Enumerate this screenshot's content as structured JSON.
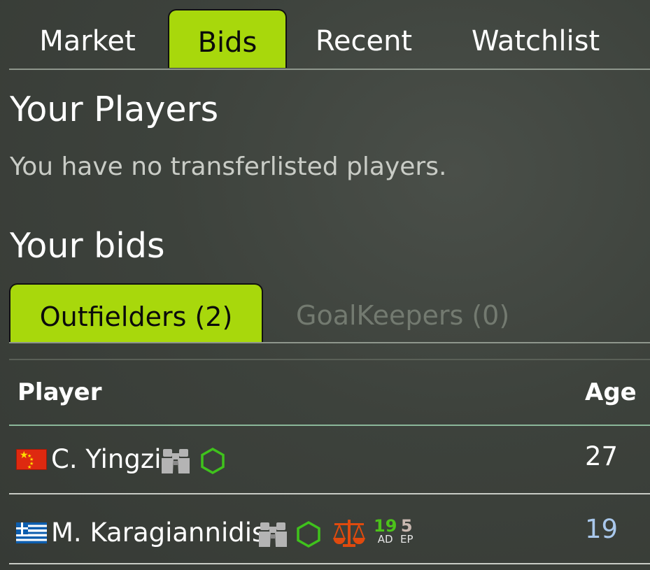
{
  "tabs": [
    {
      "label": "Market",
      "active": false
    },
    {
      "label": "Bids",
      "active": true
    },
    {
      "label": "Recent",
      "active": false
    },
    {
      "label": "Watchlist",
      "active": false
    }
  ],
  "your_players": {
    "title": "Your Players",
    "empty_message": "You have no transferlisted players."
  },
  "your_bids": {
    "title": "Your bids",
    "subtabs": [
      {
        "label": "Outfielders (2)",
        "active": true
      },
      {
        "label": "GoalKeepers (0)",
        "active": false
      }
    ]
  },
  "table": {
    "headers": {
      "player": "Player",
      "age": "Age"
    },
    "rows": [
      {
        "flag": "china-flag",
        "name": "C. Yingzi",
        "icons": [
          "binoculars-icon",
          "hexagon-icon"
        ],
        "age": "27",
        "age_color": "#ffffff"
      },
      {
        "flag": "greece-flag",
        "name": "M. Karagiannidis",
        "icons": [
          "binoculars-icon",
          "hexagon-icon",
          "scales-icon"
        ],
        "stats": [
          {
            "value": "19",
            "label": "AD",
            "color": "#4cc21a"
          },
          {
            "value": "5",
            "label": "EP",
            "color": "#c9b8b0"
          }
        ],
        "age": "19",
        "age_color": "#a9c8ec"
      }
    ]
  },
  "colors": {
    "accent": "#a8d80c",
    "background": "#3d423c",
    "hexagon": "#3fc21c",
    "scales": "#e04a0e",
    "binoculars": "#b4b4b4"
  }
}
